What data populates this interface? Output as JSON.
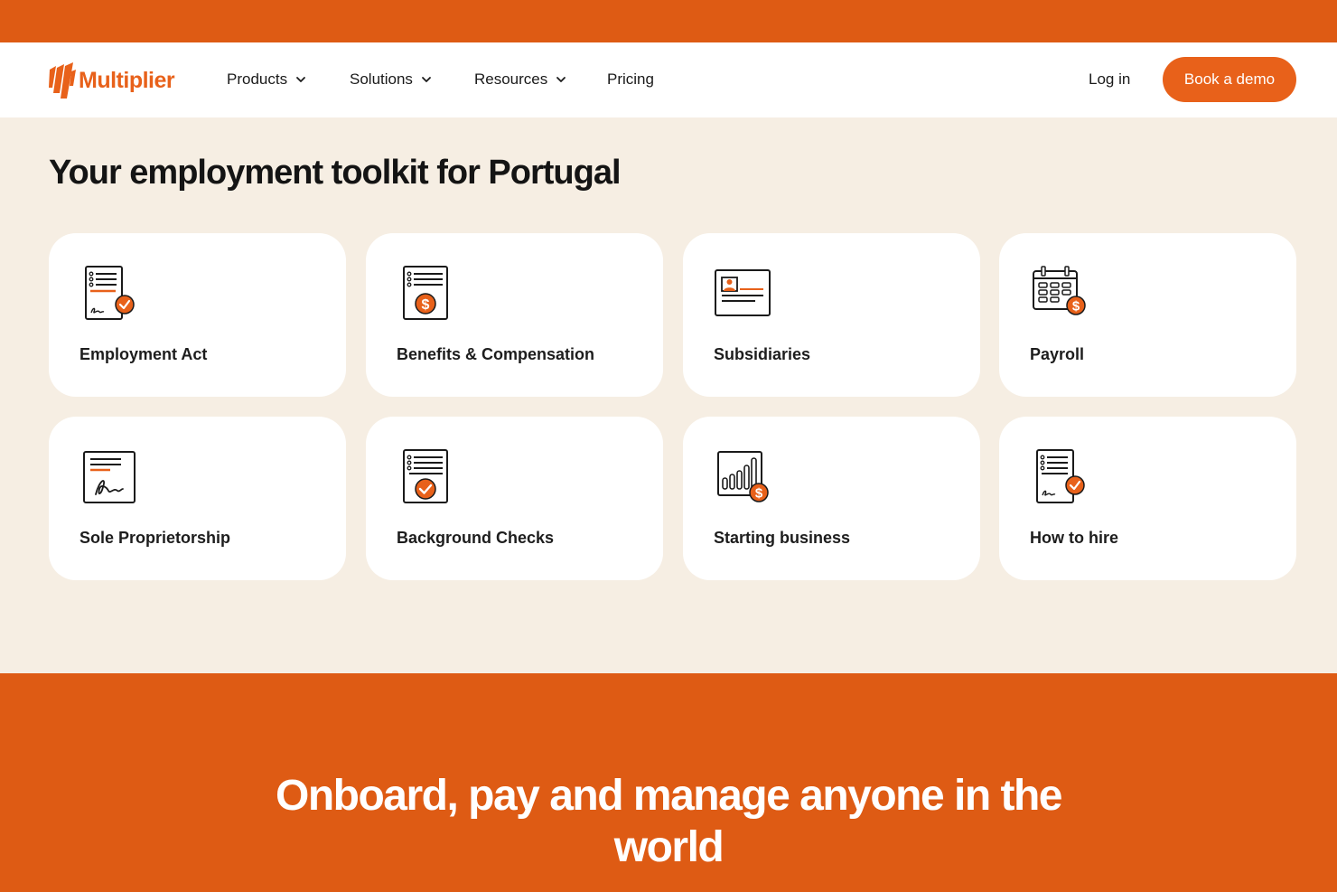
{
  "brand": {
    "name": "Multiplier",
    "accent": "#e8611a",
    "band": "#de5b14",
    "background": "#f6eee3"
  },
  "nav": {
    "items": [
      {
        "label": "Products",
        "has_dropdown": true
      },
      {
        "label": "Solutions",
        "has_dropdown": true
      },
      {
        "label": "Resources",
        "has_dropdown": true
      },
      {
        "label": "Pricing",
        "has_dropdown": false
      }
    ],
    "login": "Log in",
    "cta": "Book a demo"
  },
  "main": {
    "heading": "Your employment toolkit for Portugal",
    "cards": [
      {
        "label": "Employment Act",
        "icon": "document-signature-check-icon"
      },
      {
        "label": "Benefits & Compensation",
        "icon": "document-dollar-icon"
      },
      {
        "label": "Subsidiaries",
        "icon": "id-card-icon"
      },
      {
        "label": "Payroll",
        "icon": "calendar-dollar-icon"
      },
      {
        "label": "Sole Proprietorship",
        "icon": "signed-document-icon"
      },
      {
        "label": "Background Checks",
        "icon": "document-check-icon"
      },
      {
        "label": "Starting business",
        "icon": "bar-chart-dollar-icon"
      },
      {
        "label": "How to hire",
        "icon": "contract-check-icon"
      }
    ]
  },
  "footer_band": {
    "title": "Onboard, pay and manage anyone in the world"
  }
}
